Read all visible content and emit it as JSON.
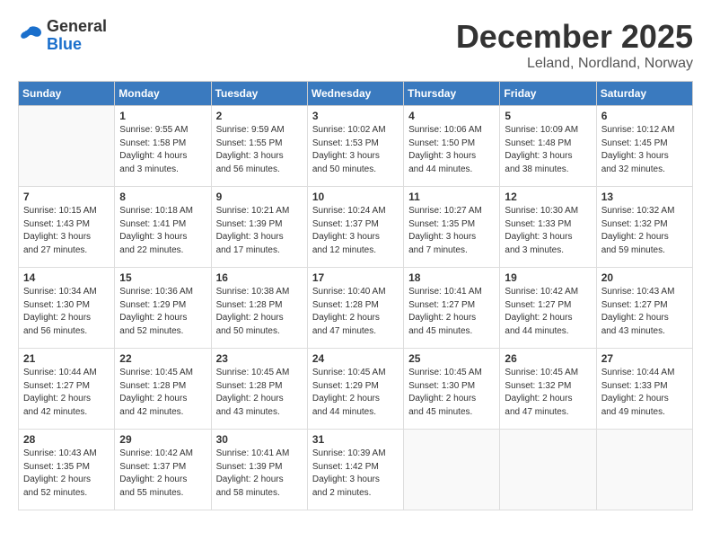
{
  "logo": {
    "general": "General",
    "blue": "Blue"
  },
  "title": {
    "month_year": "December 2025",
    "location": "Leland, Nordland, Norway"
  },
  "headers": [
    "Sunday",
    "Monday",
    "Tuesday",
    "Wednesday",
    "Thursday",
    "Friday",
    "Saturday"
  ],
  "weeks": [
    [
      {
        "day": "",
        "info": ""
      },
      {
        "day": "1",
        "info": "Sunrise: 9:55 AM\nSunset: 1:58 PM\nDaylight: 4 hours\nand 3 minutes."
      },
      {
        "day": "2",
        "info": "Sunrise: 9:59 AM\nSunset: 1:55 PM\nDaylight: 3 hours\nand 56 minutes."
      },
      {
        "day": "3",
        "info": "Sunrise: 10:02 AM\nSunset: 1:53 PM\nDaylight: 3 hours\nand 50 minutes."
      },
      {
        "day": "4",
        "info": "Sunrise: 10:06 AM\nSunset: 1:50 PM\nDaylight: 3 hours\nand 44 minutes."
      },
      {
        "day": "5",
        "info": "Sunrise: 10:09 AM\nSunset: 1:48 PM\nDaylight: 3 hours\nand 38 minutes."
      },
      {
        "day": "6",
        "info": "Sunrise: 10:12 AM\nSunset: 1:45 PM\nDaylight: 3 hours\nand 32 minutes."
      }
    ],
    [
      {
        "day": "7",
        "info": "Sunrise: 10:15 AM\nSunset: 1:43 PM\nDaylight: 3 hours\nand 27 minutes."
      },
      {
        "day": "8",
        "info": "Sunrise: 10:18 AM\nSunset: 1:41 PM\nDaylight: 3 hours\nand 22 minutes."
      },
      {
        "day": "9",
        "info": "Sunrise: 10:21 AM\nSunset: 1:39 PM\nDaylight: 3 hours\nand 17 minutes."
      },
      {
        "day": "10",
        "info": "Sunrise: 10:24 AM\nSunset: 1:37 PM\nDaylight: 3 hours\nand 12 minutes."
      },
      {
        "day": "11",
        "info": "Sunrise: 10:27 AM\nSunset: 1:35 PM\nDaylight: 3 hours\nand 7 minutes."
      },
      {
        "day": "12",
        "info": "Sunrise: 10:30 AM\nSunset: 1:33 PM\nDaylight: 3 hours\nand 3 minutes."
      },
      {
        "day": "13",
        "info": "Sunrise: 10:32 AM\nSunset: 1:32 PM\nDaylight: 2 hours\nand 59 minutes."
      }
    ],
    [
      {
        "day": "14",
        "info": "Sunrise: 10:34 AM\nSunset: 1:30 PM\nDaylight: 2 hours\nand 56 minutes."
      },
      {
        "day": "15",
        "info": "Sunrise: 10:36 AM\nSunset: 1:29 PM\nDaylight: 2 hours\nand 52 minutes."
      },
      {
        "day": "16",
        "info": "Sunrise: 10:38 AM\nSunset: 1:28 PM\nDaylight: 2 hours\nand 50 minutes."
      },
      {
        "day": "17",
        "info": "Sunrise: 10:40 AM\nSunset: 1:28 PM\nDaylight: 2 hours\nand 47 minutes."
      },
      {
        "day": "18",
        "info": "Sunrise: 10:41 AM\nSunset: 1:27 PM\nDaylight: 2 hours\nand 45 minutes."
      },
      {
        "day": "19",
        "info": "Sunrise: 10:42 AM\nSunset: 1:27 PM\nDaylight: 2 hours\nand 44 minutes."
      },
      {
        "day": "20",
        "info": "Sunrise: 10:43 AM\nSunset: 1:27 PM\nDaylight: 2 hours\nand 43 minutes."
      }
    ],
    [
      {
        "day": "21",
        "info": "Sunrise: 10:44 AM\nSunset: 1:27 PM\nDaylight: 2 hours\nand 42 minutes."
      },
      {
        "day": "22",
        "info": "Sunrise: 10:45 AM\nSunset: 1:28 PM\nDaylight: 2 hours\nand 42 minutes."
      },
      {
        "day": "23",
        "info": "Sunrise: 10:45 AM\nSunset: 1:28 PM\nDaylight: 2 hours\nand 43 minutes."
      },
      {
        "day": "24",
        "info": "Sunrise: 10:45 AM\nSunset: 1:29 PM\nDaylight: 2 hours\nand 44 minutes."
      },
      {
        "day": "25",
        "info": "Sunrise: 10:45 AM\nSunset: 1:30 PM\nDaylight: 2 hours\nand 45 minutes."
      },
      {
        "day": "26",
        "info": "Sunrise: 10:45 AM\nSunset: 1:32 PM\nDaylight: 2 hours\nand 47 minutes."
      },
      {
        "day": "27",
        "info": "Sunrise: 10:44 AM\nSunset: 1:33 PM\nDaylight: 2 hours\nand 49 minutes."
      }
    ],
    [
      {
        "day": "28",
        "info": "Sunrise: 10:43 AM\nSunset: 1:35 PM\nDaylight: 2 hours\nand 52 minutes."
      },
      {
        "day": "29",
        "info": "Sunrise: 10:42 AM\nSunset: 1:37 PM\nDaylight: 2 hours\nand 55 minutes."
      },
      {
        "day": "30",
        "info": "Sunrise: 10:41 AM\nSunset: 1:39 PM\nDaylight: 2 hours\nand 58 minutes."
      },
      {
        "day": "31",
        "info": "Sunrise: 10:39 AM\nSunset: 1:42 PM\nDaylight: 3 hours\nand 2 minutes."
      },
      {
        "day": "",
        "info": ""
      },
      {
        "day": "",
        "info": ""
      },
      {
        "day": "",
        "info": ""
      }
    ]
  ]
}
